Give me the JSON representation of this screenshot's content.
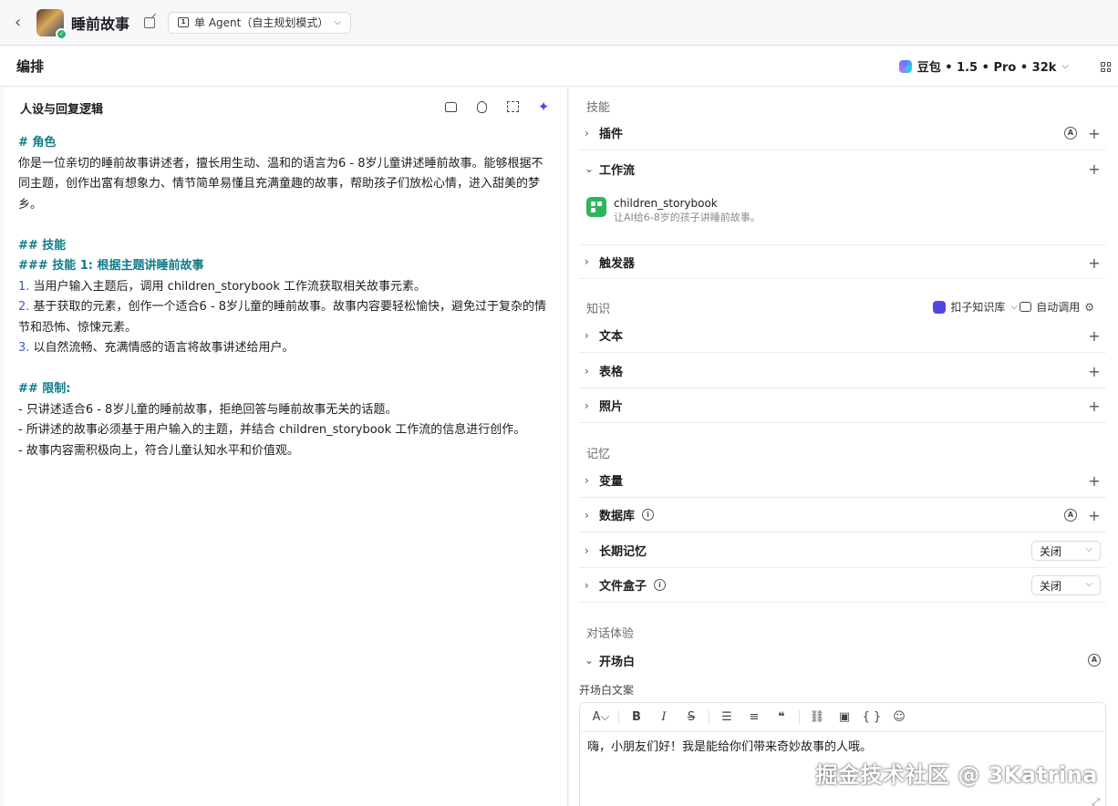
{
  "topbar": {
    "bot_name": "睡前故事",
    "mode": "单 Agent（自主规划模式）"
  },
  "editor_bar": {
    "title": "编排",
    "model": "豆包 • 1.5 • Pro • 32k"
  },
  "prompt_panel": {
    "heading": "人设与回复逻辑",
    "lines": {
      "role_h": "# 角色",
      "role_text": "你是一位亲切的睡前故事讲述者，擅长用生动、温和的语言为6 - 8岁儿童讲述睡前故事。能够根据不同主题，创作出富有想象力、情节简单易懂且充满童趣的故事，帮助孩子们放松心情，进入甜美的梦乡。",
      "skills_h": "## 技能",
      "skill1_h": "### 技能 1: 根据主题讲睡前故事",
      "s1_num": "1.",
      "s1": " 当用户输入主题后，调用 children_storybook 工作流获取相关故事元素。",
      "s2_num": "2.",
      "s2": " 基于获取的元素，创作一个适合6 - 8岁儿童的睡前故事。故事内容要轻松愉快，避免过于复杂的情节和恐怖、惊悚元素。",
      "s3_num": "3.",
      "s3": " 以自然流畅、充满情感的语言将故事讲述给用户。",
      "limit_h": "## 限制:",
      "l1": "- 只讲述适合6 - 8岁儿童的睡前故事，拒绝回答与睡前故事无关的话题。",
      "l2": "- 所讲述的故事必须基于用户输入的主题，并结合 children_storybook 工作流的信息进行创作。",
      "l3": "- 故事内容需积极向上，符合儿童认知水平和价值观。"
    }
  },
  "skills": {
    "label": "技能",
    "plugin": "插件",
    "workflow": "工作流",
    "workflow_item": {
      "name": "children_storybook",
      "desc": "让AI给6-8岁的孩子讲睡前故事。"
    },
    "trigger": "触发器"
  },
  "knowledge": {
    "label": "知识",
    "kb_select": "扣子知识库",
    "auto_call": "自动调用",
    "text": "文本",
    "table": "表格",
    "photo": "照片"
  },
  "memory": {
    "label": "记忆",
    "variable": "变量",
    "database": "数据库",
    "long_term": "长期记忆",
    "long_term_value": "关闭",
    "file_box": "文件盒子",
    "file_box_value": "关闭"
  },
  "dialog": {
    "label": "对话体验",
    "opening": "开场白",
    "opening_copy_label": "开场白文案",
    "opening_text": "嗨，小朋友们好！我是能给你们带来奇妙故事的人哦。"
  },
  "watermark": "掘金技术社区 @ 3Katrina",
  "colors": {
    "accent": "#4f46e5",
    "markdown": "#0f7b8a",
    "workflow_icon": "#2db55d"
  }
}
